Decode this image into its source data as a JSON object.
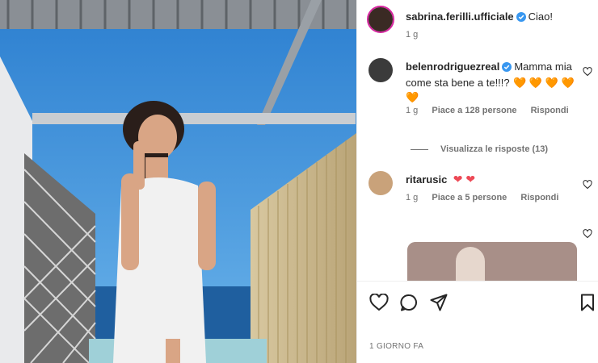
{
  "post": {
    "author": "sabrina.ferilli.ufficiale",
    "caption": "Ciao!",
    "age": "1 g"
  },
  "comments": [
    {
      "user": "belenrodriguezreal",
      "text_line1": "Mamma mia",
      "text_line2": "come sta bene a te!!!?",
      "emoji": "🧡 🧡 🧡 🧡",
      "emoji_line2": "🧡",
      "age": "1 g",
      "likes": "Piace a 128 persone",
      "reply": "Rispondi",
      "view_replies": "Visualizza le risposte (13)"
    },
    {
      "user": "ritarusic",
      "emoji": "❤ ❤",
      "age": "1 g",
      "likes": "Piace a 5 persone",
      "reply": "Rispondi"
    }
  ],
  "footer": {
    "timestamp": "1 GIORNO FA"
  },
  "icons": {
    "like": "heart-icon",
    "comment": "comment-icon",
    "share": "share-icon",
    "save": "bookmark-icon",
    "verified": "verified-badge-icon"
  },
  "colors": {
    "verified": "#3897f0",
    "orange_heart": "#f56d2a",
    "red_heart": "#ed4956",
    "meta_gray": "#737373"
  }
}
